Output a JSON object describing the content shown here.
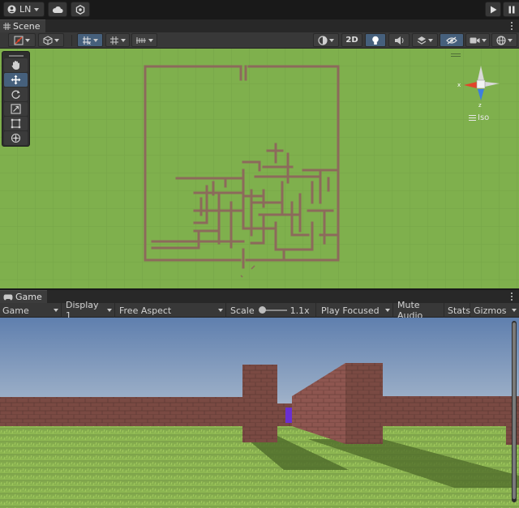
{
  "top_toolbar": {
    "account_label": "LN",
    "account_icon": "user-circle-icon",
    "cloud_icon": "cloud-icon",
    "collab_icon": "settings-hex-icon",
    "play_icon": "play-icon",
    "pause_icon": "pause-icon"
  },
  "scene": {
    "tab_label": "Scene",
    "tab_icon": "grid-hash-icon",
    "toolbar": {
      "btn_2d": "2D"
    },
    "tools": [
      "hand-tool",
      "move-tool",
      "rotate-tool",
      "scale-tool",
      "rect-tool",
      "transform-tool"
    ],
    "active_tool": "move-tool",
    "gizmo": {
      "projection_label": "Iso",
      "x_axis_label": "x",
      "z_axis_label": "z",
      "x_color": "#e2452b",
      "y_color": "#8ec63f",
      "z_color": "#3d7ee0"
    }
  },
  "game": {
    "tab_label": "Game",
    "tab_icon": "gamepad-icon",
    "toolbar": {
      "mode": "Game",
      "display": "Display 1",
      "aspect": "Free Aspect",
      "scale_label": "Scale",
      "scale_value": "1.1x",
      "play_mode": "Play Focused",
      "mute_audio": "Mute Audio",
      "stats": "Stats",
      "gizmos": "Gizmos"
    }
  },
  "colors": {
    "editor_bg": "#191919",
    "panel_bg": "#383838",
    "active_blue": "#46607c",
    "ground_green": "#7fb04d",
    "maze_wall": "#8c6a5b",
    "sky_top": "#5f7fae",
    "brick": "#7a4a43"
  }
}
